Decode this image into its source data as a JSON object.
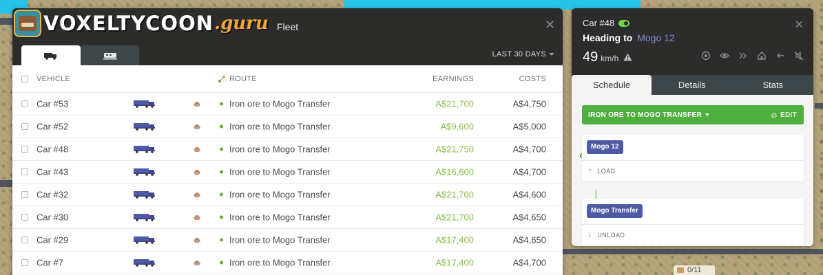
{
  "logo": {
    "word": "VOXELTYCOON",
    "suffix": ".guru"
  },
  "fleet": {
    "title": "Fleet",
    "tabs": [
      {
        "icon": "truck-icon",
        "active": true
      },
      {
        "icon": "train-icon",
        "active": false
      }
    ],
    "period": "LAST 30 DAYS",
    "columns": {
      "vehicle": "VEHICLE",
      "route": "ROUTE",
      "earnings": "EARNINGS",
      "costs": "COSTS"
    },
    "rows": [
      {
        "vehicle": "Car #53",
        "route": "Iron ore to Mogo Transfer",
        "earnings": "A$21,700",
        "costs": "A$4,750"
      },
      {
        "vehicle": "Car #52",
        "route": "Iron ore to Mogo Transfer",
        "earnings": "A$9,600",
        "costs": "A$5,000"
      },
      {
        "vehicle": "Car #48",
        "route": "Iron ore to Mogo Transfer",
        "earnings": "A$21,750",
        "costs": "A$4,700"
      },
      {
        "vehicle": "Car #43",
        "route": "Iron ore to Mogo Transfer",
        "earnings": "A$16,600",
        "costs": "A$4,700"
      },
      {
        "vehicle": "Car #32",
        "route": "Iron ore to Mogo Transfer",
        "earnings": "A$21,700",
        "costs": "A$4,600"
      },
      {
        "vehicle": "Car #30",
        "route": "Iron ore to Mogo Transfer",
        "earnings": "A$21,700",
        "costs": "A$4,650"
      },
      {
        "vehicle": "Car #29",
        "route": "Iron ore to Mogo Transfer",
        "earnings": "A$17,400",
        "costs": "A$4,650"
      },
      {
        "vehicle": "Car #7",
        "route": "Iron ore to Mogo Transfer",
        "earnings": "A$17,400",
        "costs": "A$4,700"
      }
    ]
  },
  "car": {
    "title": "Car #48",
    "heading_label": "Heading to",
    "destination": "Mogo 12",
    "speed": "49",
    "speed_unit": "km/h",
    "tabs": [
      "Schedule",
      "Details",
      "Stats"
    ],
    "route_name": "IRON ORE TO MOGO TRANSFER",
    "edit_label": "EDIT",
    "stops": [
      {
        "name": "Mogo 12",
        "action": "LOAD"
      },
      {
        "name": "Mogo Transfer",
        "action": "UNLOAD"
      }
    ]
  },
  "counter": "0/11",
  "colors": {
    "earnings": "#86c04a",
    "route_bar": "#4fb040",
    "stop_chip": "#4f5aa6",
    "destination": "#7d8fe0"
  }
}
